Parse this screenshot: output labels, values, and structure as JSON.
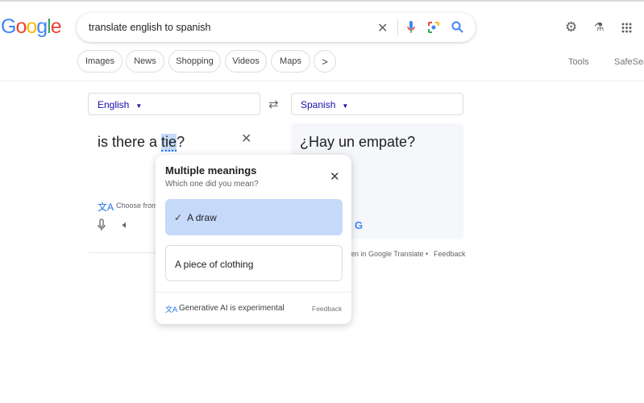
{
  "header": {
    "logo": "Google",
    "search_query": "translate english to spanish",
    "icons": [
      "close-icon",
      "mic-icon",
      "lens-icon",
      "search-icon",
      "gear-icon",
      "labs-icon",
      "apps-icon"
    ]
  },
  "chips": [
    "Images",
    "News",
    "Shopping",
    "Videos",
    "Maps",
    ">"
  ],
  "tools": {
    "tools_label": "Tools",
    "safesearch_label": "SafeSea"
  },
  "translate": {
    "source_lang": "English",
    "target_lang": "Spanish",
    "source_before": "is there a ",
    "source_highlight": "tie",
    "source_after": "?",
    "target_text": "¿Hay un empate?",
    "choose_from": "Choose from",
    "open_in": "pen in Google Translate",
    "dot": "•",
    "feedback": "Feedback"
  },
  "popup": {
    "title": "Multiple meanings",
    "subtitle": "Which one did you mean?",
    "options": [
      {
        "label": "A draw",
        "selected": true
      },
      {
        "label": "A piece of clothing",
        "selected": false
      }
    ],
    "footer": "Generative AI is experimental",
    "feedback": "Feedback",
    "check": "✓"
  },
  "colors": {
    "accent": "#1a73e8",
    "selected_bg": "#c6d9f9",
    "link": "#1a0dab"
  }
}
